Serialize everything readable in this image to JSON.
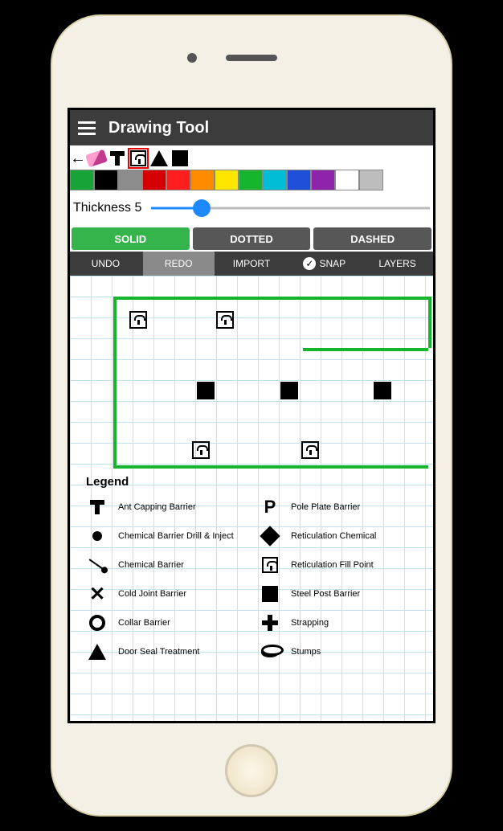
{
  "header": {
    "title": "Drawing Tool"
  },
  "tools": {
    "back": "←",
    "selected": "tap"
  },
  "palette": [
    "#17a338",
    "#000000",
    "#8c8c8c",
    "#d60000",
    "#ff1e1e",
    "#ff8c00",
    "#ffe600",
    "#17b52e",
    "#00bcd4",
    "#1e4fd6",
    "#8e24aa",
    "#ffffff",
    "#bdbdbd"
  ],
  "thickness": {
    "label": "Thickness",
    "value": "5"
  },
  "styles": {
    "solid": "SOLID",
    "dotted": "DOTTED",
    "dashed": "DASHED",
    "active": "solid"
  },
  "actions": {
    "undo": "UNDO",
    "redo": "REDO",
    "import": "IMPORT",
    "snap": "SNAP",
    "layers": "LAYERS",
    "snap_checked": true
  },
  "legend_title": "Legend",
  "legend_left": [
    {
      "icon": "tee",
      "label": "Ant Capping Barrier"
    },
    {
      "icon": "dot",
      "label": "Chemical Barrier Drill & Inject"
    },
    {
      "icon": "line-dot",
      "label": "Chemical Barrier"
    },
    {
      "icon": "x",
      "label": "Cold Joint Barrier"
    },
    {
      "icon": "circle",
      "label": "Collar Barrier"
    },
    {
      "icon": "triangle",
      "label": "Door Seal Treatment"
    }
  ],
  "legend_right": [
    {
      "icon": "P",
      "label": "Pole Plate Barrier"
    },
    {
      "icon": "diamond",
      "label": "Reticulation Chemical"
    },
    {
      "icon": "tap",
      "label": "Reticulation Fill Point"
    },
    {
      "icon": "square",
      "label": "Steel Post Barrier"
    },
    {
      "icon": "plus",
      "label": "Strapping"
    },
    {
      "icon": "cylinder",
      "label": "Stumps"
    }
  ]
}
